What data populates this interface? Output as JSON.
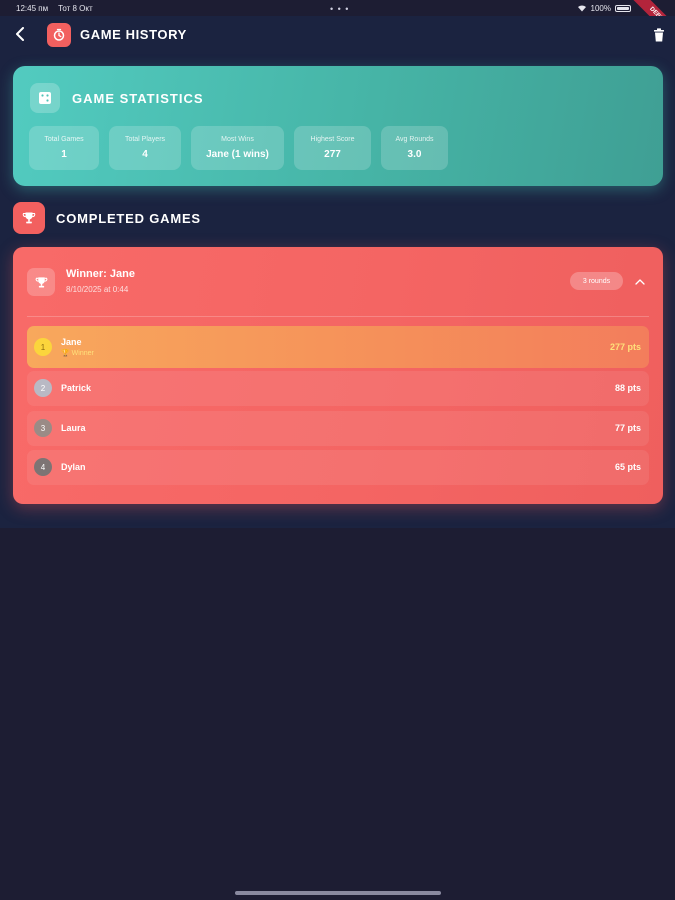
{
  "status_bar": {
    "time": "12:45 пм",
    "date": "Тот 8 Окт",
    "dots": "• • •",
    "battery": "100%",
    "debug": "DEBUG"
  },
  "app_bar": {
    "title": "GAME HISTORY",
    "title_icon": "timer-icon",
    "back_icon": "chevron-left-icon",
    "action_icon": "trash-icon"
  },
  "stats": {
    "title": "GAME STATISTICS",
    "icon": "dice-icon",
    "tiles": [
      {
        "label": "Total Games",
        "value": "1"
      },
      {
        "label": "Total Players",
        "value": "4"
      },
      {
        "label": "Most Wins",
        "value": "Jane (1 wins)"
      },
      {
        "label": "Highest Score",
        "value": "277"
      },
      {
        "label": "Avg Rounds",
        "value": "3.0"
      }
    ]
  },
  "completed": {
    "title": "COMPLETED GAMES",
    "icon": "trophy-icon"
  },
  "game": {
    "winner_title": "Winner: Jane",
    "date": "8/10/2025 at 0:44",
    "rounds": "3 rounds",
    "players": [
      {
        "rank": "1",
        "name": "Jane",
        "tag": "🏆 Winner",
        "score": "277 pts"
      },
      {
        "rank": "2",
        "name": "Patrick",
        "score": "88 pts"
      },
      {
        "rank": "3",
        "name": "Laura",
        "score": "77 pts"
      },
      {
        "rank": "4",
        "name": "Dylan",
        "score": "65 pts"
      }
    ]
  },
  "colors": {
    "background": "#1d1d33",
    "app_bar": "#1b2340",
    "teal": "#4fc3b7",
    "coral": "#f4625f",
    "gold": "#fbd53c",
    "silver": "#b9b9c4",
    "bronze": "#9a8b86",
    "fourth": "#7d7474"
  }
}
